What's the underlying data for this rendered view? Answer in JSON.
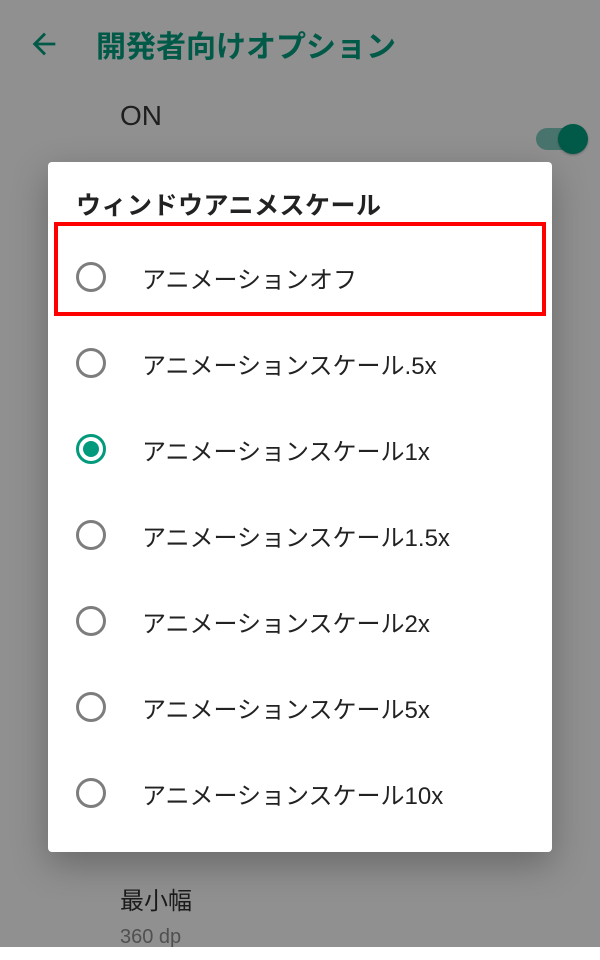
{
  "header": {
    "title": "開発者向けオプション"
  },
  "page": {
    "master_toggle_label": "ON",
    "min_width_label": "最小幅",
    "min_width_value": "360 dp"
  },
  "dialog": {
    "title": "ウィンドウアニメスケール",
    "selected_index": 2,
    "options": [
      "アニメーションオフ",
      "アニメーションスケール.5x",
      "アニメーションスケール1x",
      "アニメーションスケール1.5x",
      "アニメーションスケール2x",
      "アニメーションスケール5x",
      "アニメーションスケール10x"
    ]
  }
}
